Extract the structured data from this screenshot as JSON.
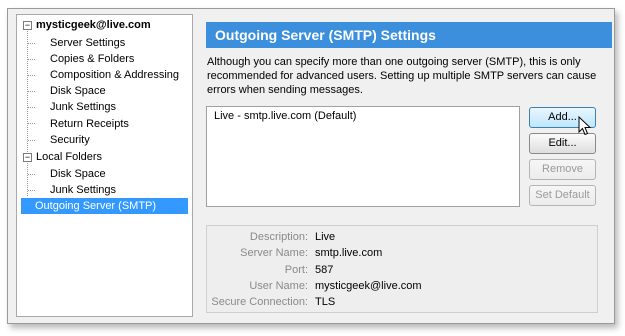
{
  "tree": {
    "account": "mysticgeek@live.com",
    "account_items": [
      "Server Settings",
      "Copies & Folders",
      "Composition & Addressing",
      "Disk Space",
      "Junk Settings",
      "Return Receipts",
      "Security"
    ],
    "local": "Local Folders",
    "local_items": [
      "Disk Space",
      "Junk Settings"
    ],
    "outgoing": "Outgoing Server (SMTP)",
    "expander_glyph": "−"
  },
  "main": {
    "title": "Outgoing Server (SMTP) Settings",
    "description_line1": "Although you can specify more than one outgoing server (SMTP), this is only",
    "description_line2": "recommended for advanced users. Setting up multiple SMTP servers can cause",
    "description_line3": "errors when sending messages.",
    "server_list": [
      "Live - smtp.live.com (Default)"
    ]
  },
  "buttons": {
    "add": "Add...",
    "edit": "Edit...",
    "remove": "Remove",
    "set_default": "Set Default"
  },
  "details": {
    "description_label": "Description:",
    "description_value": "Live",
    "server_name_label": "Server Name:",
    "server_name_value": "smtp.live.com",
    "port_label": "Port:",
    "port_value": "587",
    "user_name_label": "User Name:",
    "user_name_value": "mysticgeek@live.com",
    "secure_connection_label": "Secure Connection:",
    "secure_connection_value": "TLS"
  },
  "colors": {
    "header_bg": "#3c8fdc",
    "selection_bg": "#3399ff"
  },
  "icons": [
    "expander-minus-icon",
    "mouse-cursor-icon"
  ]
}
